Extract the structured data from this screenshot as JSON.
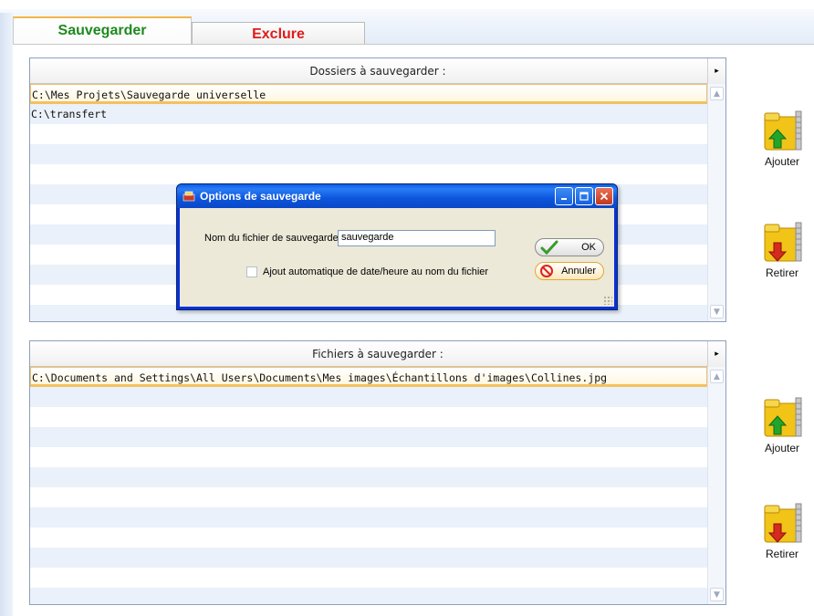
{
  "tabs": {
    "save": "Sauvegarder",
    "exclude": "Exclure"
  },
  "folders_panel": {
    "header": "Dossiers à sauvegarder :",
    "rows": [
      "C:\\Mes Projets\\Sauvegarde universelle",
      "C:\\transfert"
    ]
  },
  "files_panel": {
    "header": "Fichiers à sauvegarder :",
    "rows": [
      "C:\\Documents and Settings\\All Users\\Documents\\Mes images\\Échantillons d'images\\Collines.jpg"
    ]
  },
  "side_buttons": {
    "add_folder": "Ajouter",
    "remove_folder": "Retirer",
    "add_file": "Ajouter",
    "remove_file": "Retirer"
  },
  "dialog": {
    "title": "Options de sauvegarde",
    "filename_label": "Nom du fichier de sauvegarde :",
    "filename_value": "sauvegarde",
    "auto_date_label": "Ajout automatique de date/heure au nom du fichier",
    "auto_date_checked": false,
    "ok_label": "OK",
    "cancel_label": "Annuler"
  },
  "colors": {
    "save_tab": "#1f8a1f",
    "exclude_tab": "#e01b1b",
    "selection_border": "#f2c06b",
    "xp_title_blue": "#0a5ee8"
  }
}
